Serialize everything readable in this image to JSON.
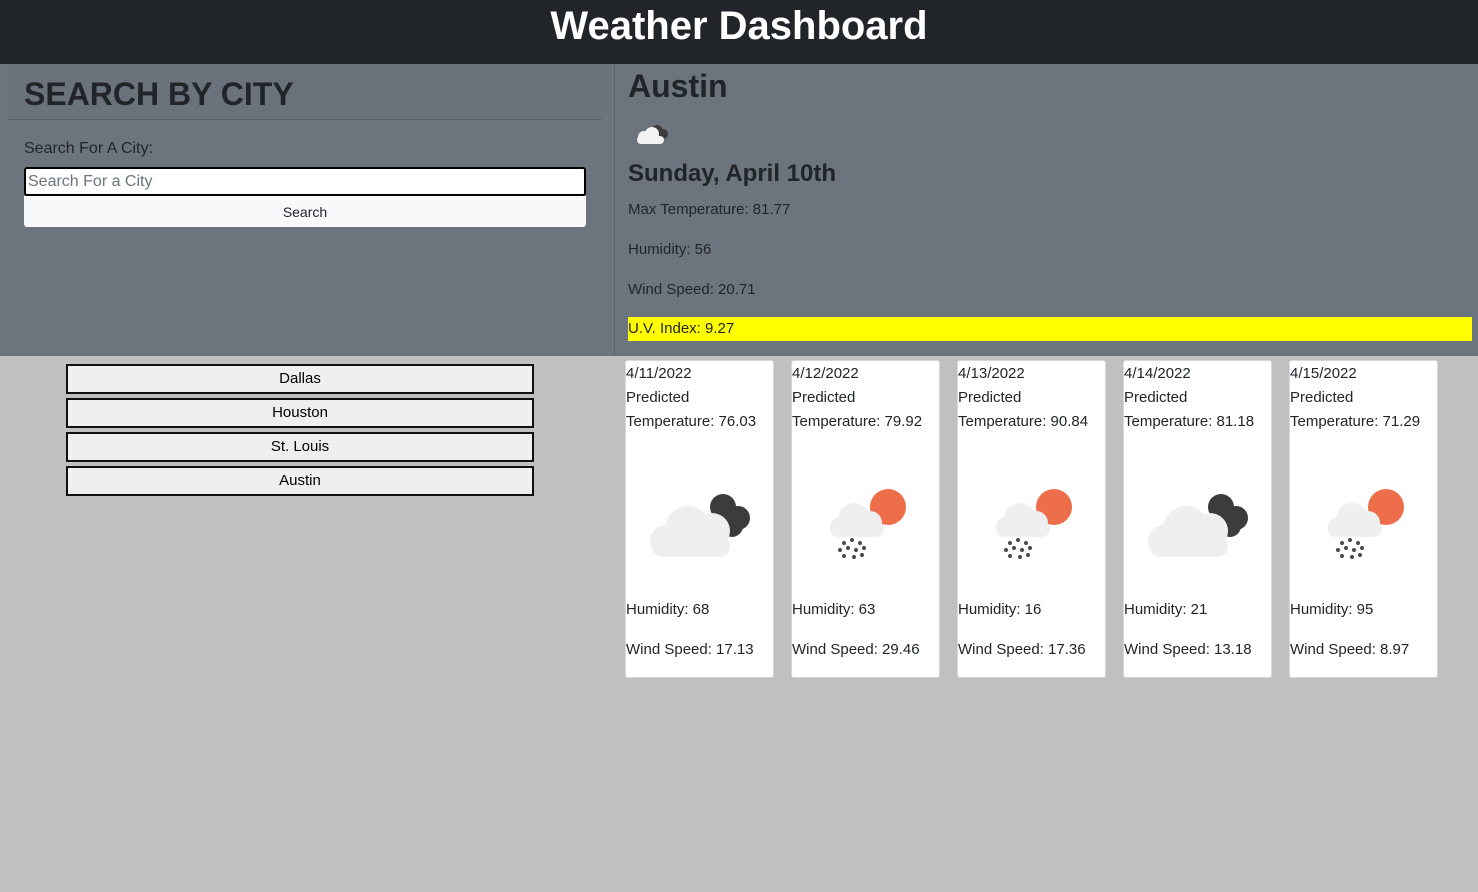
{
  "header": {
    "title": "Weather Dashboard"
  },
  "search": {
    "heading": "SEARCH BY CITY",
    "label": "Search For A City:",
    "placeholder": "Search For a City",
    "button_label": "Search"
  },
  "history": [
    "Dallas",
    "Houston",
    "St. Louis",
    "Austin"
  ],
  "current": {
    "city": "Austin",
    "icon": "cloud-icon",
    "date": "Sunday, April 10th",
    "max_temp": "Max Temperature: 81.77",
    "humidity": "Humidity: 56",
    "wind": "Wind Speed: 20.71",
    "uv": "U.V. Index: 9.27",
    "uv_color": "#ffff00"
  },
  "forecast": [
    {
      "date": "4/11/2022",
      "predicted": "Predicted",
      "temp": "Temperature: 76.03",
      "icon": "cloudy-night-icon",
      "humidity": "Humidity: 68",
      "wind": "Wind Speed: 17.13"
    },
    {
      "date": "4/12/2022",
      "predicted": "Predicted",
      "temp": "Temperature: 79.92",
      "icon": "snow-sun-icon",
      "humidity": "Humidity: 63",
      "wind": "Wind Speed: 29.46"
    },
    {
      "date": "4/13/2022",
      "predicted": "Predicted",
      "temp": "Temperature: 90.84",
      "icon": "snow-sun-icon",
      "humidity": "Humidity: 16",
      "wind": "Wind Speed: 17.36"
    },
    {
      "date": "4/14/2022",
      "predicted": "Predicted",
      "temp": "Temperature: 81.18",
      "icon": "cloudy-night-icon",
      "humidity": "Humidity: 21",
      "wind": "Wind Speed: 13.18"
    },
    {
      "date": "4/15/2022",
      "predicted": "Predicted",
      "temp": "Temperature: 71.29",
      "icon": "snow-sun-icon",
      "humidity": "Humidity: 95",
      "wind": "Wind Speed: 8.97"
    }
  ],
  "colors": {
    "header_bg": "#212529",
    "panel_bg": "#6c757d",
    "page_bg": "#c0c0c0",
    "sun": "#ee6e4c",
    "dark_cloud": "#3c3c3c"
  }
}
